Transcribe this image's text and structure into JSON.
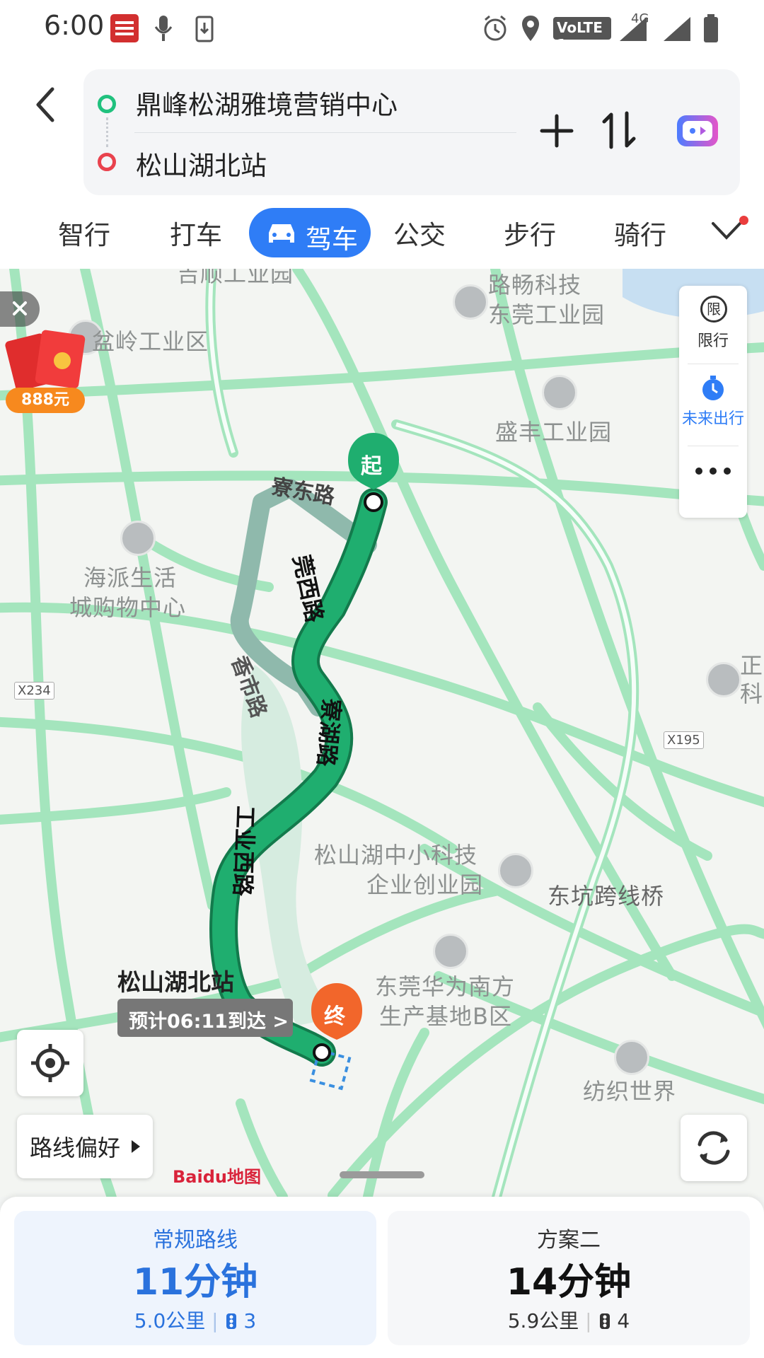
{
  "status_bar": {
    "time": "6:00",
    "network_badge": "VoLTE 1",
    "network_type": "4G"
  },
  "route": {
    "origin": "鼎峰松湖雅境营销中心",
    "destination": "松山湖北站"
  },
  "mode_tabs": [
    "智行",
    "打车",
    "驾车",
    "公交",
    "步行",
    "骑行"
  ],
  "active_tab": "驾车",
  "map": {
    "red_packet_amount": "888元",
    "right_controls": {
      "limit_icon_char": "限",
      "limit_label": "限行",
      "future_label": "未来出行"
    },
    "start_marker": "起",
    "end_marker": "终",
    "destination_label": "松山湖北站",
    "eta_label": "预计06:11到达 >",
    "road_labels": {
      "r1": "寮东路",
      "r2": "莞西路",
      "r3": "寮湖路",
      "r4": "工业西路",
      "r5": "香市路"
    },
    "place_labels": {
      "p1": "盆岭工业区",
      "p2": "路畅科技",
      "p3": "东莞工业园",
      "p4": "盛丰工业园",
      "p5": "海派生活",
      "p6": "城购物中心",
      "p7": "松山湖中小科技",
      "p8": "企业创业园",
      "p9": "东坑跨线桥",
      "p10": "东莞华为南方",
      "p11": "生产基地B区",
      "p12": "纺织世界",
      "p13": "正",
      "p14": "科",
      "p15": "吉顺工业园"
    },
    "road_shields": {
      "s1": "X234",
      "s2": "X195"
    },
    "route_preference": "路线偏好",
    "baidu_logo": "Baidu地图",
    "colors": {
      "active_route": "#1fae6f",
      "alt_route": "#8fb9ac",
      "roads": "#9ee3b9",
      "accent": "#2f7df6"
    }
  },
  "route_options": [
    {
      "name": "常规路线",
      "duration": "11分钟",
      "distance": "5.0公里",
      "lights": "3"
    },
    {
      "name": "方案二",
      "duration": "14分钟",
      "distance": "5.9公里",
      "lights": "4"
    }
  ]
}
